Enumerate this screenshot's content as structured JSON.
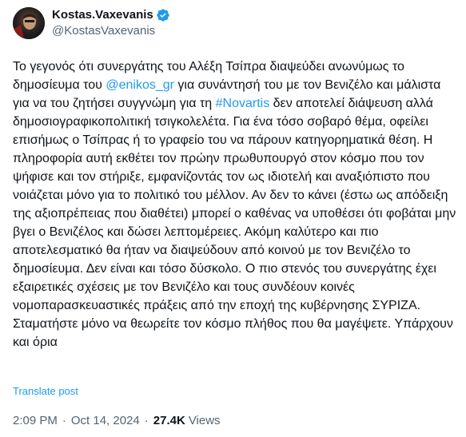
{
  "author": {
    "display_name": "Kostas.Vaxevanis",
    "handle": "@KostasVaxevanis"
  },
  "tweet": {
    "segments": [
      {
        "type": "text",
        "text": "Το γεγονός ότι συνεργάτης του Αλέξη Τσίπρα  διαψεύδει ανωνύμως το δημοσίευμα του "
      },
      {
        "type": "mention",
        "text": "@enikos_gr"
      },
      {
        "type": "text",
        "text": " για συνάντησή του με τον Βενιζέλο και μάλιστα για να του ζητήσει συγγνώμη για τη "
      },
      {
        "type": "hashtag",
        "text": "#Novartis"
      },
      {
        "type": "text",
        "text": " δεν αποτελεί διάψευση αλλά δημοσιογραφικοπολιτική τσιγκολελέτα. Για ένα τόσο σοβαρό θέμα, οφείλει επισήμως ο Τσίπρας ή το γραφείο του να πάρουν κατηγορηματικά θέση. Η πληροφορία αυτή εκθέτει τον πρώην πρωθυπουργό στον κόσμο που τον ψήφισε και τον στήριξε, εμφανίζοντάς τον ως ιδιοτελή και αναξιόπιστο που νοιάζεται μόνο για το πολιτικό του μέλλον. Αν δεν το κάνει (έστω ως απόδειξη της αξιοπρέπειας που διαθέτει) μπορεί ο καθένας να υποθέσει ότι φοβάται μην βγει ο Βενιζέλος και δώσει λεπτομέρειες. Ακόμη καλύτερο και πιο αποτελεσματικό θα ήταν να διαψεύδουν από κοινού με τον Βενιζέλο το δημοσίευμα. Δεν είναι και τόσο δύσκολο. Ο πιο στενός του συνεργάτης έχει εξαιρετικές σχέσεις με τον Βενιζέλο και τους συνδέουν κοινές νομοπαρασκευαστικές πράξεις από την εποχή της κυβέρνησης ΣΥΡΙΖΑ. Σταματήστε μόνο να θεωρείτε τον κόσμο πλήθος που θα μαγέψετε. Υπάρχουν και όρια"
      }
    ],
    "translate_label": "Translate post",
    "time": "2:09 PM",
    "date": "Oct 14, 2024",
    "separator": "·",
    "views_count": "27.4K",
    "views_label": "Views"
  },
  "colors": {
    "link": "#1d9bf0",
    "verified": "#1d9bf0",
    "secondary_text": "#536471",
    "primary_text": "#0f1419"
  },
  "icons": {
    "verified": "verified-badge-icon"
  }
}
